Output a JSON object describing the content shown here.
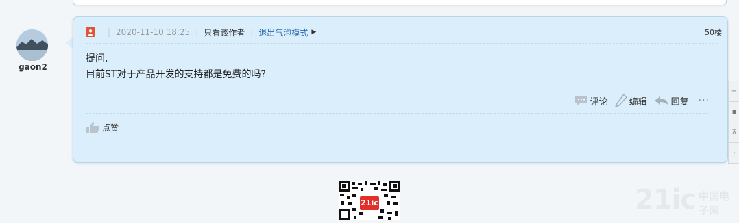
{
  "post": {
    "username": "gaon2",
    "date": "2020-11-10 18:25",
    "only_author": "只看该作者",
    "bubble_mode": "退出气泡模式",
    "floor": "50楼",
    "content_lines": [
      "提问,",
      "目前ST对于产品开发的支持都是免费的吗?"
    ],
    "actions": {
      "comment": "评论",
      "edit": "编辑",
      "reply": "回复",
      "more": "···"
    },
    "like": "点赞"
  },
  "side_tools": [
    "=",
    "▪",
    "⊼",
    "⋮"
  ],
  "qr": {
    "label": "21ic"
  },
  "watermark": {
    "main": "21ic",
    "sub": "中国电子网"
  },
  "colors": {
    "bubble_bg": "#daeefb",
    "link": "#2a6db3",
    "user_icon": "#e0553a"
  }
}
